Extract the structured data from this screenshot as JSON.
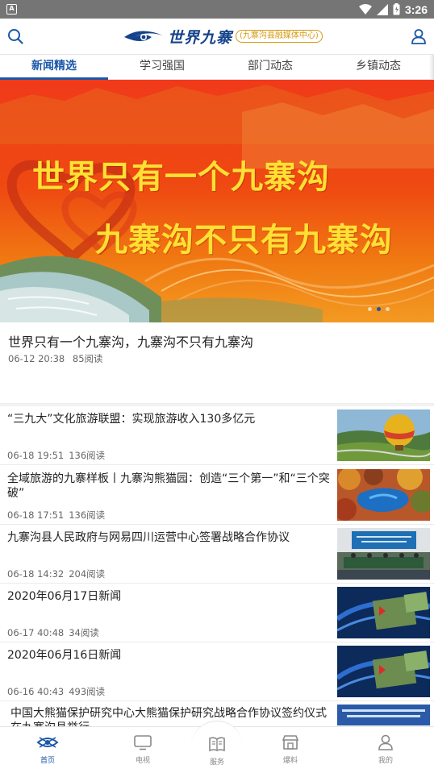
{
  "status_bar": {
    "time": "3:26",
    "notification_icon": "A"
  },
  "header": {
    "logo_title": "世界九寨",
    "logo_subtitle": "九寨沟县融媒体中心",
    "search_icon": "search-icon",
    "user_icon": "user-icon"
  },
  "tabs": [
    {
      "label": "新闻精选",
      "active": true
    },
    {
      "label": "学习强国",
      "active": false
    },
    {
      "label": "部门动态",
      "active": false
    },
    {
      "label": "乡镇动态",
      "active": false
    }
  ],
  "banner": {
    "line1": "世界只有一个九寨沟",
    "line2": "九寨沟不只有九寨沟",
    "pages": 3,
    "current_page": 2
  },
  "featured": {
    "title": "世界只有一个九寨沟，九寨沟不只有九寨沟",
    "time": "06-12 20:38",
    "reads": "85阅读"
  },
  "news": [
    {
      "title": "“三九大”文化旅游联盟：实现旅游收入130多亿元",
      "time": "06-18 19:51",
      "reads": "136阅读",
      "thumb": "balloon"
    },
    {
      "title": "全域旅游的九寨样板丨九寨沟熊猫园：创造“三个第一”和“三个突破”",
      "time": "06-18 17:51",
      "reads": "136阅读",
      "thumb": "lake"
    },
    {
      "title": "九寨沟县人民政府与网易四川运营中心签署战略合作协议",
      "time": "06-18 14:32",
      "reads": "204阅读",
      "thumb": "meeting"
    },
    {
      "title": "2020年06月17日新闻",
      "time": "06-17 40:48",
      "reads": "34阅读",
      "thumb": "studio"
    },
    {
      "title": "2020年06月16日新闻",
      "time": "06-16 40:43",
      "reads": "493阅读",
      "thumb": "studio"
    },
    {
      "title": "中国大熊猫保护研究中心大熊猫保护研究战略合作协议签约仪式在九寨沟县举行",
      "time": "",
      "reads": "",
      "thumb": "blue"
    }
  ],
  "bottom_nav": [
    {
      "label": "首页",
      "icon": "home-icon",
      "active": true
    },
    {
      "label": "电视",
      "icon": "tv-icon",
      "active": false
    },
    {
      "label": "服务",
      "icon": "book-icon",
      "active": false
    },
    {
      "label": "爆料",
      "icon": "store-icon",
      "active": false
    },
    {
      "label": "我的",
      "icon": "profile-icon",
      "active": false
    }
  ],
  "colors": {
    "accent": "#1b57a8",
    "banner_red": "#f03a1a",
    "banner_text": "#ffe033",
    "logo_gold": "#d79a14"
  }
}
